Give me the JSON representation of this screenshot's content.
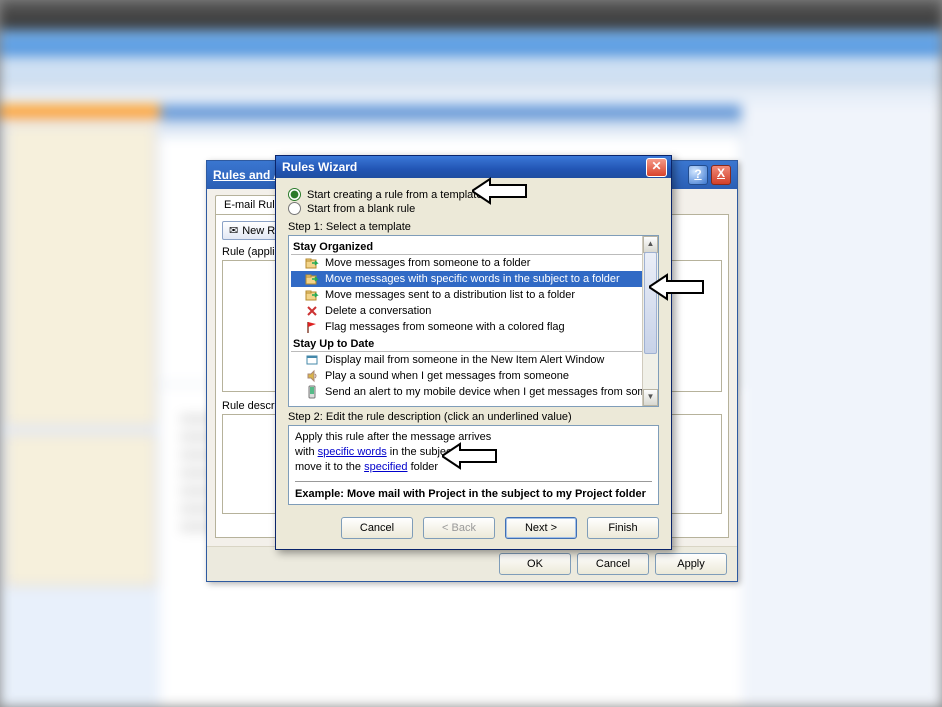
{
  "back_dialog": {
    "title": "Rules and Alerts",
    "tab_label": "E-mail Rules",
    "new_rule_button": "New Rule...",
    "rule_header": "Rule (applied in the order shown)",
    "rule_desc_label": "Rule description (click an underlined value to edit):",
    "buttons": {
      "ok": "OK",
      "cancel": "Cancel",
      "apply": "Apply"
    },
    "help_icon": "?",
    "close_icon": "X"
  },
  "wizard": {
    "title": "Rules Wizard",
    "radio": {
      "template": "Start creating a rule from a template",
      "blank": "Start from a blank rule"
    },
    "step1_label": "Step 1: Select a template",
    "categories": {
      "organized": "Stay Organized",
      "uptodate": "Stay Up to Date"
    },
    "templates": {
      "organized": [
        {
          "icon": "move-folder",
          "label": "Move messages from someone to a folder"
        },
        {
          "icon": "move-folder",
          "label": "Move messages with specific words in the subject to a folder",
          "selected": true
        },
        {
          "icon": "move-folder",
          "label": "Move messages sent to a distribution list to a folder"
        },
        {
          "icon": "delete-x",
          "label": "Delete a conversation"
        },
        {
          "icon": "flag",
          "label": "Flag messages from someone with a colored flag"
        }
      ],
      "uptodate": [
        {
          "icon": "alert",
          "label": "Display mail from someone in the New Item Alert Window"
        },
        {
          "icon": "sound",
          "label": "Play a sound when I get messages from someone"
        },
        {
          "icon": "mobile",
          "label": "Send an alert to my mobile device when I get messages from someone"
        }
      ]
    },
    "step2_label": "Step 2: Edit the rule description (click an underlined value)",
    "description": {
      "line1_pre": "Apply this rule after the message arrives",
      "line2_pre": "with ",
      "line2_link": "specific words",
      "line2_post": " in the subject",
      "line3_pre": "move it to the ",
      "line3_link": "specified",
      "line3_post": " folder"
    },
    "example": "Example: Move mail with Project in the subject to my Project folder",
    "buttons": {
      "cancel": "Cancel",
      "back": "< Back",
      "next": "Next >",
      "finish": "Finish"
    }
  }
}
